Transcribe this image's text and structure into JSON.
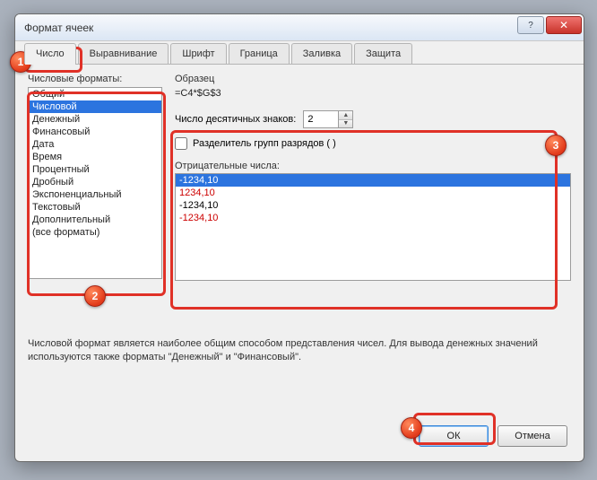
{
  "window": {
    "title": "Формат ячеек"
  },
  "tabs": [
    {
      "label": "Число"
    },
    {
      "label": "Выравнивание"
    },
    {
      "label": "Шрифт"
    },
    {
      "label": "Граница"
    },
    {
      "label": "Заливка"
    },
    {
      "label": "Защита"
    }
  ],
  "labels": {
    "categories": "Числовые форматы:",
    "sample": "Образец",
    "decimal_places": "Число десятичных знаков:",
    "thousands_sep": "Разделитель групп разрядов ( )",
    "negative_numbers": "Отрицательные числа:"
  },
  "categories": [
    {
      "label": "Общий",
      "selected": false
    },
    {
      "label": "Числовой",
      "selected": true
    },
    {
      "label": "Денежный",
      "selected": false
    },
    {
      "label": "Финансовый",
      "selected": false
    },
    {
      "label": "Дата",
      "selected": false
    },
    {
      "label": "Время",
      "selected": false
    },
    {
      "label": "Процентный",
      "selected": false
    },
    {
      "label": "Дробный",
      "selected": false
    },
    {
      "label": "Экспоненциальный",
      "selected": false
    },
    {
      "label": "Текстовый",
      "selected": false
    },
    {
      "label": "Дополнительный",
      "selected": false
    },
    {
      "label": "(все форматы)",
      "selected": false
    }
  ],
  "sample_value": "=C4*$G$3",
  "decimal_value": "2",
  "thousands_checked": false,
  "negative_numbers": [
    {
      "label": "-1234,10",
      "color": "#ffffff",
      "selected": true
    },
    {
      "label": "1234,10",
      "color": "#cc0000",
      "selected": false
    },
    {
      "label": "-1234,10",
      "color": "#000000",
      "selected": false
    },
    {
      "label": "-1234,10",
      "color": "#cc0000",
      "selected": false
    }
  ],
  "description": "Числовой формат является наиболее общим способом представления чисел. Для вывода денежных значений используются также форматы \"Денежный\" и \"Финансовый\".",
  "buttons": {
    "ok": "ОК",
    "cancel": "Отмена"
  },
  "badges": {
    "b1": "1",
    "b2": "2",
    "b3": "3",
    "b4": "4"
  }
}
